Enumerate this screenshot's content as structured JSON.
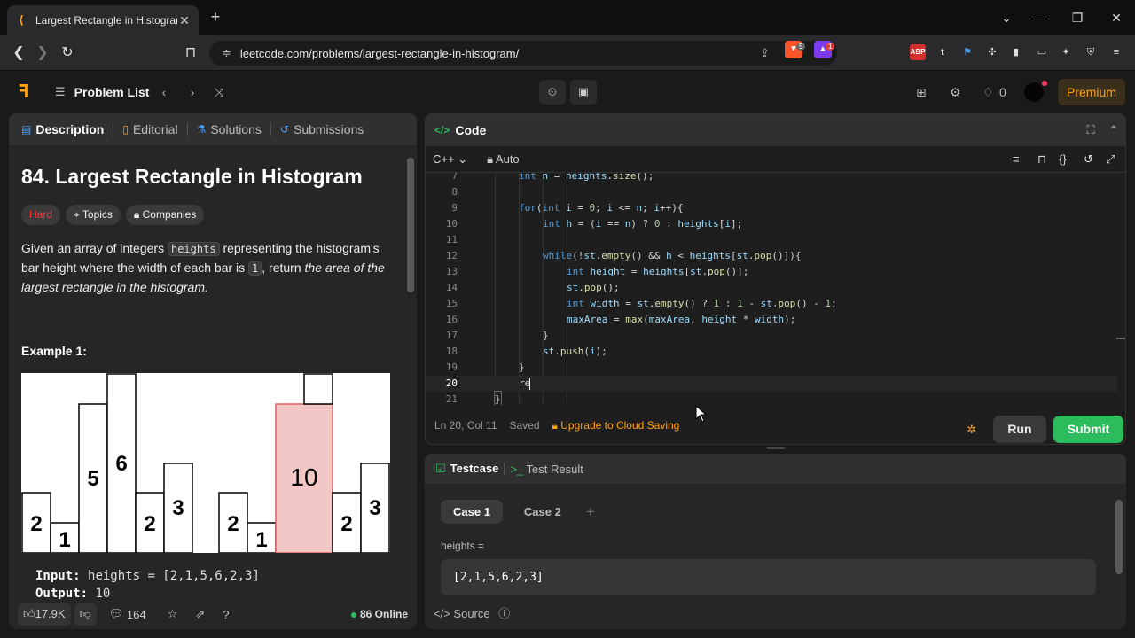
{
  "browser": {
    "tab_title": "Largest Rectangle in Histogram",
    "tab_close": "✕",
    "new_tab": "+",
    "url": "leetcode.com/problems/largest-rectangle-in-histogram/",
    "ext_badges": {
      "brave_count": "5",
      "rewards_count": "1"
    }
  },
  "lc_nav": {
    "problem_list": "Problem List",
    "streak_count": "0",
    "premium": "Premium"
  },
  "left": {
    "tabs": [
      "Description",
      "Editorial",
      "Solutions",
      "Submissions"
    ],
    "title": "84. Largest Rectangle in Histogram",
    "chips": {
      "difficulty": "Hard",
      "topics": "Topics",
      "companies": "Companies"
    },
    "desc": {
      "p1": "Given an array of integers ",
      "code1": "heights",
      "p2": " representing the histogram's bar height where the width of each bar is ",
      "code2": "1",
      "p3": ", return ",
      "em": "the area of the largest rectangle in the histogram."
    },
    "example_title": "Example 1:",
    "histogram": {
      "bar_labels": [
        "2",
        "1",
        "5",
        "6",
        "2",
        "3",
        "2",
        "1",
        "10",
        "2",
        "3"
      ]
    },
    "io": {
      "input_label": "Input:",
      "input_value": "heights = [2,1,5,6,2,3]",
      "output_label": "Output:",
      "output_value": "10"
    },
    "bottom": {
      "likes": "17.9K",
      "comments": "164",
      "online": "86 Online"
    }
  },
  "code": {
    "header": "Code",
    "language": "C++",
    "mode": "Auto",
    "lines": [
      {
        "n": "7",
        "text": "int n = heights.size();"
      },
      {
        "n": "8",
        "text": ""
      },
      {
        "n": "9",
        "text": "for(int i = 0; i <= n; i++){"
      },
      {
        "n": "10",
        "text": "int h = (i == n) ? 0 : heights[i];"
      },
      {
        "n": "11",
        "text": ""
      },
      {
        "n": "12",
        "text": "while(!st.empty() && h < heights[st.pop()]){"
      },
      {
        "n": "13",
        "text": "int height = heights[st.pop()];"
      },
      {
        "n": "14",
        "text": "st.pop();"
      },
      {
        "n": "15",
        "text": "int width = st.empty() ? 1 : 1 - st.pop() - 1;"
      },
      {
        "n": "16",
        "text": "maxArea = max(maxArea, height * width);"
      },
      {
        "n": "17",
        "text": "}"
      },
      {
        "n": "18",
        "text": "st.push(i);"
      },
      {
        "n": "19",
        "text": "}"
      },
      {
        "n": "20",
        "text": "re"
      },
      {
        "n": "21",
        "text": "}"
      }
    ],
    "status": {
      "position": "Ln 20, Col 11",
      "saved": "Saved",
      "upgrade": "Upgrade to Cloud Saving"
    },
    "run": "Run",
    "submit": "Submit"
  },
  "test": {
    "tabs": {
      "testcase": "Testcase",
      "result": "Test Result"
    },
    "cases": [
      "Case 1",
      "Case 2"
    ],
    "add_case": "+",
    "param_label": "heights =",
    "param_value": "[2,1,5,6,2,3]",
    "source": "Source"
  }
}
